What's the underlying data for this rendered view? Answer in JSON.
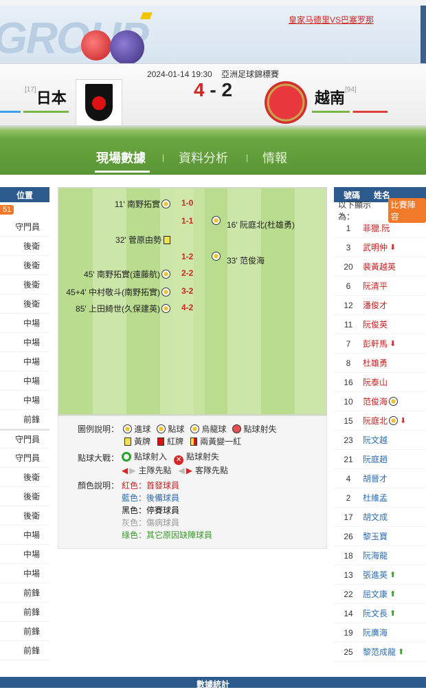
{
  "banner": {
    "logo_text": "GROUP",
    "promo_link": "皇家马德里VS巴塞罗那"
  },
  "match": {
    "datetime": "2024-01-14 19:30",
    "competition": "亞洲足球錦標賽",
    "home": {
      "name": "日本",
      "rank": "[17]"
    },
    "away": {
      "name": "越南",
      "rank": "[94]"
    },
    "score_home": "4",
    "score_sep": "-",
    "score_away": "2"
  },
  "tabs": [
    {
      "label": "現場數據"
    },
    {
      "label": "資料分析"
    },
    {
      "label": "情報"
    }
  ],
  "tab_sep": "|",
  "left_panel": {
    "header": "位置",
    "badge": "51",
    "positions": [
      "守門員",
      "後衛",
      "後衛",
      "後衛",
      "後衛",
      "中場",
      "中場",
      "中場",
      "中場",
      "中場",
      "前鋒",
      "守門員",
      "守門員",
      "後衛",
      "後衛",
      "後衛",
      "中場",
      "中場",
      "中場",
      "前鋒",
      "前鋒",
      "前鋒",
      "前鋒"
    ]
  },
  "right_panel": {
    "header_num": "號碼",
    "header_name": "姓名",
    "note_label": "以下顯示為：",
    "note_badge": "比賽陣容",
    "players": [
      {
        "num": "1",
        "name": "菲獵.阮",
        "type": "starter",
        "mark": ""
      },
      {
        "num": "3",
        "name": "武明仲",
        "type": "starter",
        "mark": "down"
      },
      {
        "num": "20",
        "name": "裴黃越英",
        "type": "starter",
        "mark": ""
      },
      {
        "num": "6",
        "name": "阮清平",
        "type": "starter",
        "mark": ""
      },
      {
        "num": "12",
        "name": "潘俊才",
        "type": "starter",
        "mark": ""
      },
      {
        "num": "11",
        "name": "阮俊英",
        "type": "starter",
        "mark": ""
      },
      {
        "num": "7",
        "name": "彭軒馬",
        "type": "starter",
        "mark": "down"
      },
      {
        "num": "8",
        "name": "杜雄勇",
        "type": "starter",
        "mark": ""
      },
      {
        "num": "16",
        "name": "阮泰山",
        "type": "starter",
        "mark": ""
      },
      {
        "num": "10",
        "name": "范俊海",
        "type": "starter",
        "mark": "goal"
      },
      {
        "num": "15",
        "name": "阮庭北",
        "type": "starter",
        "mark": "goal-down"
      },
      {
        "num": "23",
        "name": "阮文越",
        "type": "sub",
        "mark": ""
      },
      {
        "num": "21",
        "name": "阮庭趙",
        "type": "sub",
        "mark": ""
      },
      {
        "num": "4",
        "name": "胡晉才",
        "type": "sub",
        "mark": ""
      },
      {
        "num": "2",
        "name": "杜維孟",
        "type": "sub",
        "mark": ""
      },
      {
        "num": "17",
        "name": "胡文成",
        "type": "sub",
        "mark": ""
      },
      {
        "num": "26",
        "name": "黎玉寶",
        "type": "sub",
        "mark": ""
      },
      {
        "num": "18",
        "name": "阮海龍",
        "type": "sub",
        "mark": ""
      },
      {
        "num": "13",
        "name": "張進英",
        "type": "sub",
        "mark": "up"
      },
      {
        "num": "22",
        "name": "屈文康",
        "type": "sub",
        "mark": "up"
      },
      {
        "num": "14",
        "name": "阮文長",
        "type": "sub",
        "mark": "up"
      },
      {
        "num": "19",
        "name": "阮廣海",
        "type": "sub",
        "mark": ""
      },
      {
        "num": "25",
        "name": "黎范成龍",
        "type": "sub",
        "mark": "up"
      }
    ]
  },
  "timeline": {
    "events": [
      {
        "home": "11' 南野拓實",
        "home_icon": "goal",
        "score": "1-0",
        "away": "",
        "away_icon": ""
      },
      {
        "home": "",
        "home_icon": "",
        "score": "1-1",
        "away": "16' 阮庭北(杜雄勇)",
        "away_icon": "goal"
      },
      {
        "home": "32' 菅原由勢",
        "home_icon": "yellow",
        "score": "",
        "away": "",
        "away_icon": ""
      },
      {
        "home": "",
        "home_icon": "",
        "score": "1-2",
        "away": "33' 范俊海",
        "away_icon": "goal"
      },
      {
        "home": "45' 南野拓實(遠藤航)",
        "home_icon": "goal",
        "score": "2-2",
        "away": "",
        "away_icon": ""
      },
      {
        "home": "45+4' 中村敬斗(南野拓實)",
        "home_icon": "goal",
        "score": "3-2",
        "away": "",
        "away_icon": ""
      },
      {
        "home": "85' 上田綺世(久保建英)",
        "home_icon": "goal",
        "score": "4-2",
        "away": "",
        "away_icon": ""
      }
    ]
  },
  "legend": {
    "icons_label": "圖例說明：",
    "goal": "進球",
    "penalty": "點球",
    "own_goal": "烏龍球",
    "penalty_miss": "點球射失",
    "yellow": "黃牌",
    "red": "紅牌",
    "second_yellow": "兩黃變一紅",
    "shootout_label": "點球大戰：",
    "shootout_hit": "點球射入",
    "shootout_miss": "點球射失",
    "home_first": "主隊先點",
    "away_first": "客隊先點",
    "color_label": "顏色說明：",
    "c_red": "紅色：首發球員",
    "c_blue": "藍色：後備球員",
    "c_black": "黑色：停賽球員",
    "c_gray": "灰色：傷病球員",
    "c_green": "綠色：其它原因缺陣球員"
  },
  "bottom": {
    "title": "數據統計"
  },
  "colors": {
    "header_blue": "#2c5a8c",
    "pitch_green": "#6aa640",
    "badge_orange": "#f07a2a",
    "starter_red": "#c81e1e",
    "sub_blue": "#2c6db3"
  }
}
